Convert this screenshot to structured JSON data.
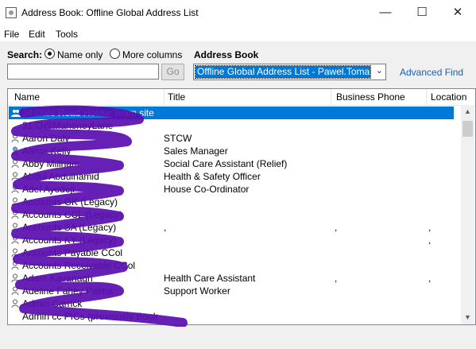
{
  "window": {
    "title": "Address Book: Offline Global Address List"
  },
  "menu": [
    "File",
    "Edit",
    "Tools"
  ],
  "search": {
    "label": "Search:",
    "option_name_only": "Name only",
    "option_more_columns": "More columns",
    "selected": "Name only",
    "go_label": "Go",
    "value": ""
  },
  "address_book": {
    "label": "Address Book",
    "selected": "Offline Global Address List - Pawel.Tomal.",
    "advanced_find": "Advanced Find"
  },
  "table": {
    "columns": [
      "Name",
      "Title",
      "Business Phone",
      "Location"
    ],
    "rows": [
      {
        "name": "34 Dale Road House Team site",
        "title": "",
        "phone": "",
        "location": "",
        "icon": "group-icon",
        "selected": true
      },
      {
        "name": "31 O@MahoneyLane",
        "title": "",
        "phone": "",
        "location": "",
        "icon": "none"
      },
      {
        "name": "Aaron Daly",
        "title": "STCW",
        "phone": "",
        "location": "",
        "icon": "person-icon"
      },
      {
        "name": "Aaron Kelly",
        "title": "Sales Manager",
        "phone": "",
        "location": "",
        "icon": "person-contact-icon"
      },
      {
        "name": "Abby Millham",
        "title": "Social Care Assistant (Relief)",
        "phone": "",
        "location": "",
        "icon": "person-icon"
      },
      {
        "name": "Abdul Abdulhamid",
        "title": "Health & Safety Officer",
        "phone": "",
        "location": "",
        "icon": "person-icon"
      },
      {
        "name": "Adel Ayodeji",
        "title": "House Co-Ordinator",
        "phone": "",
        "location": "",
        "icon": "person-icon"
      },
      {
        "name": "Accounts GK (Legacy)",
        "title": "",
        "phone": "",
        "location": "",
        "icon": "person-icon"
      },
      {
        "name": "Accounts CCL (Legacy)",
        "title": "",
        "phone": "",
        "location": "",
        "icon": "person-icon"
      },
      {
        "name": "Accounts SA (Legacy)",
        "title": ",",
        "phone": ",",
        "location": ",",
        "icon": "person-icon"
      },
      {
        "name": "Accounts KY (Legacy)",
        "title": "",
        "phone": "",
        "location": ",",
        "icon": "person-icon"
      },
      {
        "name": "Accounts Payable CCol",
        "title": "",
        "phone": "",
        "location": "",
        "icon": "person-icon"
      },
      {
        "name": "Accounts Receivable CCol",
        "title": "",
        "phone": "",
        "location": "",
        "icon": "person-icon"
      },
      {
        "name": "Adam Kavanagh",
        "title": "Health Care Assistant",
        "phone": ",",
        "location": ",",
        "icon": "person-icon"
      },
      {
        "name": "Adeline Fahey Palma",
        "title": "Support Worker",
        "phone": "",
        "location": "",
        "icon": "person-icon"
      },
      {
        "name": "Admin Carrick",
        "title": "",
        "phone": "",
        "location": "",
        "icon": "person-icon"
      },
      {
        "name": "Admin cc PICs (previously Book",
        "title": "",
        "phone": "",
        "location": "",
        "icon": "none"
      }
    ]
  },
  "colors": {
    "selection": "#0078d7",
    "scribble": "#5a0fb0",
    "link": "#1a5fb4"
  }
}
